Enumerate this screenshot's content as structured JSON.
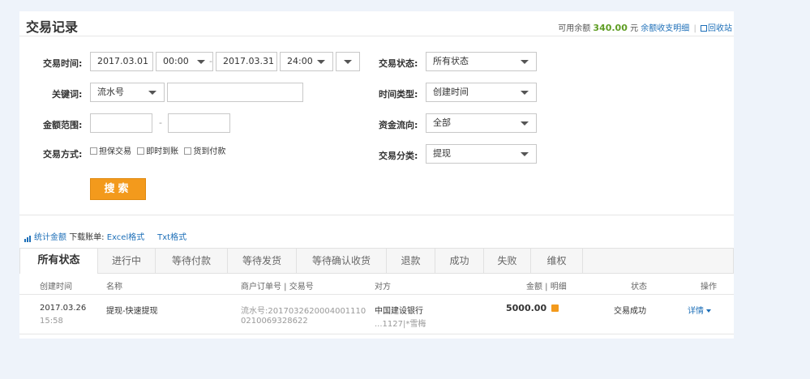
{
  "header": {
    "title": "交易记录",
    "balance_label": "可用余额",
    "balance_amount": "340.00",
    "balance_unit": "元",
    "balance_detail_link": "余额收支明细",
    "separator": "|",
    "recycle_link": "回收站"
  },
  "filters": {
    "trade_time_label": "交易时间:",
    "start_date": "2017.03.01",
    "start_time": "00:00",
    "date_dash": "-",
    "end_date": "2017.03.31",
    "end_time": "24:00",
    "keyword_label": "关键词:",
    "keyword_type": "流水号",
    "keyword_value": "",
    "amount_label": "金额范围:",
    "amount_min": "",
    "amount_dash": "-",
    "amount_max": "",
    "method_label": "交易方式:",
    "methods": [
      "担保交易",
      "即时到账",
      "货到付款"
    ],
    "status_label": "交易状态:",
    "status_value": "所有状态",
    "time_type_label": "时间类型:",
    "time_type_value": "创建时间",
    "flow_label": "资金流向:",
    "flow_value": "全部",
    "category_label": "交易分类:",
    "category_value": "提现",
    "search_button": "搜索"
  },
  "stats_bar": {
    "stats_link": "统计金额",
    "download_label": "下载账单:",
    "excel_link": "Excel格式",
    "txt_link": "Txt格式"
  },
  "tabs": [
    "所有状态",
    "进行中",
    "等待付款",
    "等待发货",
    "等待确认收货",
    "退款",
    "成功",
    "失败",
    "维权"
  ],
  "table": {
    "columns": {
      "created": "创建时间",
      "name": "名称",
      "order_no": "商户订单号 | 交易号",
      "party": "对方",
      "amount": "金额 | 明细",
      "status": "状态",
      "action": "操作"
    },
    "rows": [
      {
        "date": "2017.03.26",
        "time": "15:58",
        "name": "提现-快速提现",
        "serial_line1": "流水号:2017032620004001110",
        "serial_line2": "0210069328622",
        "party_line1": "中国建设银行",
        "party_line2": "...1127|*雪梅",
        "amount": "5000.00",
        "status": "交易成功",
        "action": "详情"
      }
    ]
  },
  "colors": {
    "accent": "#f39a1c",
    "link": "#1d6fb8",
    "balance": "#5f9d24"
  }
}
